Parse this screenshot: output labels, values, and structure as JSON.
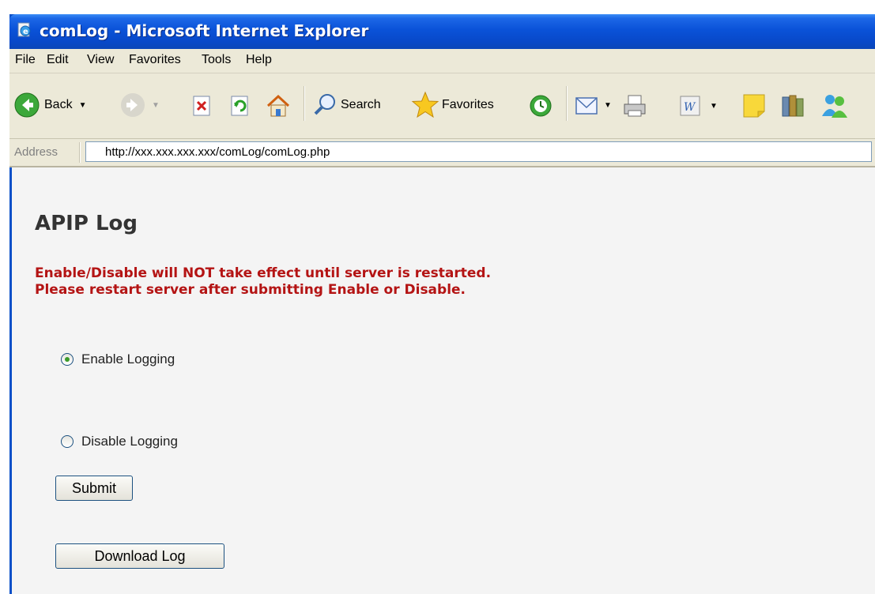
{
  "window": {
    "title": "comLog - Microsoft Internet Explorer"
  },
  "menu": [
    "File",
    "Edit",
    "View",
    "Favorites",
    "Tools",
    "Help"
  ],
  "toolbar": {
    "back_label": "Back",
    "search_label": "Search",
    "favorites_label": "Favorites"
  },
  "address": {
    "label": "Address",
    "url": "http://xxx.xxx.xxx.xxx/comLog/comLog.php"
  },
  "page": {
    "title": "APIP Log",
    "warning_line1": "Enable/Disable will NOT take effect until server is restarted.",
    "warning_line2": "Please restart server after submitting Enable or Disable.",
    "enable_label": "Enable Logging",
    "disable_label": "Disable Logging",
    "selected": "enable",
    "submit_label": "Submit",
    "download_label": "Download Log"
  },
  "colors": {
    "title_bar": "#0a52d8",
    "warning": "#b41414",
    "content_bg": "#f4f4f4"
  }
}
